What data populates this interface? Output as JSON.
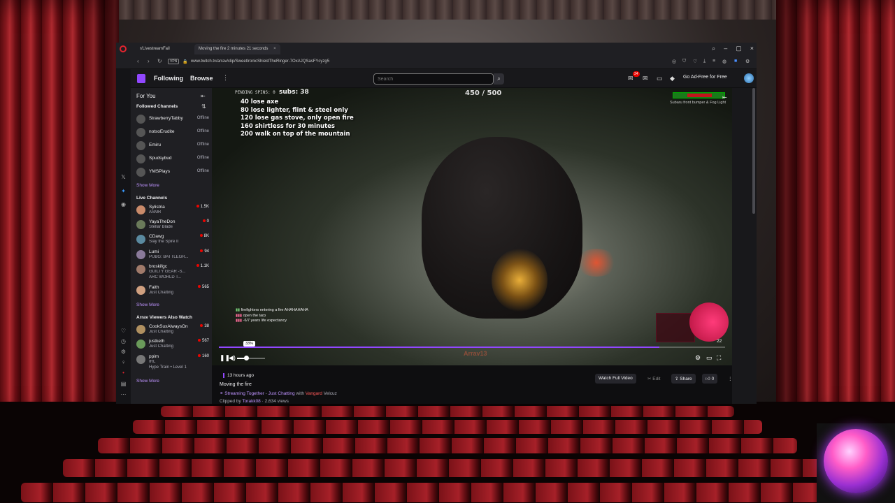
{
  "browser": {
    "tabs": [
      {
        "label": "r/LivestreamFail"
      },
      {
        "label": "Moving the fire",
        "extra": "2 minutes 21 seconds"
      }
    ],
    "url": "www.twitch.tv/arrav/clip/SweetIronicShieldTheRinger-7OxAJQSasFYcyzg5",
    "vpn_label": "VPN"
  },
  "topnav": {
    "following": "Following",
    "browse": "Browse",
    "search_placeholder": "Search",
    "notif_count": "34",
    "adfree": "Go Ad-Free for Free"
  },
  "sidebar": {
    "for_you": "For You",
    "followed_title": "Followed Channels",
    "followed": [
      {
        "name": "StrawberryTabby",
        "status": "Offline"
      },
      {
        "name": "notsoErudite",
        "status": "Offline"
      },
      {
        "name": "Emiru",
        "status": "Offline"
      },
      {
        "name": "Spudsybud",
        "status": "Offline"
      },
      {
        "name": "YMSPlays",
        "status": "Offline"
      }
    ],
    "show_more": "Show More",
    "live_title": "Live Channels",
    "live": [
      {
        "name": "Sylistria",
        "game": "ASMR",
        "viewers": "1.5K"
      },
      {
        "name": "YayaTheDon",
        "game": "Stellar Blade",
        "viewers": "0"
      },
      {
        "name": "CDawg",
        "game": "Slay the Spire II",
        "viewers": "8K"
      },
      {
        "name": "Lumi",
        "game": "PUBG: BATTLEGR...",
        "viewers": "94"
      },
      {
        "name": "broskifgc",
        "game": "GUILTY GEAR -S...",
        "game2": "ARC WORLD T...",
        "viewers": "1.1K"
      },
      {
        "name": "Faith",
        "game": "Just Chatting",
        "viewers": "565"
      }
    ],
    "also_title": "Arrav Viewers Also Watch",
    "also": [
      {
        "name": "CookSuxAlwaysOn",
        "game": "Just Chatting",
        "viewers": "38"
      },
      {
        "name": "justketh",
        "game": "Just Chatting",
        "viewers": "567"
      },
      {
        "name": "ppim",
        "game": "IRL",
        "hype": "Hype Train • Level 1",
        "viewers": "160"
      }
    ]
  },
  "video": {
    "pending": "PENDING SPINS: 0",
    "subs": "subs: 38",
    "counter": "450 / 500",
    "rules": [
      "40 lose axe",
      "80 lose lighter, flint & steel only",
      "120 lose gas stove, only open fire",
      "160 shirtless for 30 minutes",
      "200 walk on top of the mountain"
    ],
    "tracker_text": "Subaru front bumper & Fog Light",
    "chat": [
      {
        "user": "",
        "msg": "firefighters entering a fire AHAHAHAHA"
      },
      {
        "user": "",
        "msg": "open the tarp"
      },
      {
        "user": "",
        "msg": "-6/7 years life expectancy"
      }
    ],
    "volume_tip": "33%",
    "volume": 0.33,
    "progress": 0.87,
    "time_right": "22",
    "watermark": "Arrav13"
  },
  "below": {
    "ago": "13 hours ago",
    "title": "Moving the fire",
    "stream_together": "Streaming Together",
    "category": "Just Chatting",
    "with": "with",
    "partner1": "Vangard",
    "partner2": "Velcuz",
    "clipped_by_label": "Clipped by",
    "clipper": "Torakk08",
    "views": "2,634 views",
    "watch_full": "Watch Full Video",
    "edit": "Edit",
    "share": "Share",
    "likes": "0"
  }
}
